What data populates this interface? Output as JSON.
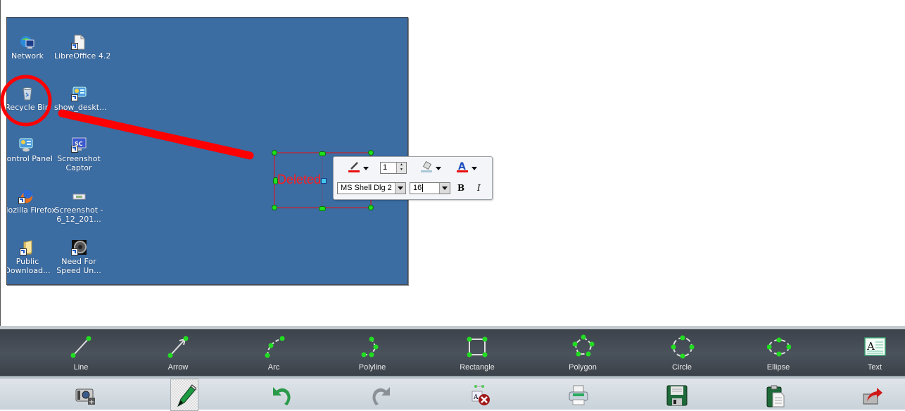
{
  "desktop": {
    "icons": [
      {
        "name": "network",
        "label": "Network",
        "icon": "network-icon"
      },
      {
        "name": "libreoffice",
        "label": "LibreOffice 4.2",
        "icon": "document-icon"
      },
      {
        "name": "recycle-bin",
        "label": "Recycle Bin",
        "icon": "trash-icon"
      },
      {
        "name": "show-desktop",
        "label": "show_deskt...",
        "icon": "app-shortcut-icon"
      },
      {
        "name": "control-panel",
        "label": "Control Panel",
        "icon": "control-panel-icon"
      },
      {
        "name": "screenshot-captor",
        "label1": "Screenshot",
        "label2": "Captor",
        "icon": "screenshot-captor-icon"
      },
      {
        "name": "mozilla-firefox",
        "label": "Mozilla Firefox",
        "icon": "firefox-icon"
      },
      {
        "name": "screenshot-file",
        "label1": "Screenshot -",
        "label2": "6_12_201...",
        "icon": "image-file-icon"
      },
      {
        "name": "public-downloads",
        "label1": "Public",
        "label2": "Download...",
        "icon": "folder-icon"
      },
      {
        "name": "need-for-speed",
        "label1": "Need For",
        "label2": "Speed Un...",
        "icon": "game-icon"
      }
    ]
  },
  "annotations": {
    "text_box": {
      "text": "Deleted",
      "color": "#ff1a1a"
    },
    "highlight_color": "#ff0000"
  },
  "format_bar": {
    "line_color_icon": "pen-color-icon",
    "line_width": "1",
    "fill_color_icon": "fill-bucket-icon",
    "font_color_icon": "font-color-icon",
    "font_name": "MS Shell Dlg 2",
    "font_size": "16",
    "bold_label": "B",
    "italic_label": "I",
    "line_color": "#e81010",
    "fill_color": "#a9c7d8",
    "font_color": "#e81010"
  },
  "shape_tools": [
    {
      "id": "line",
      "label": "Line"
    },
    {
      "id": "arrow",
      "label": "Arrow"
    },
    {
      "id": "arc",
      "label": "Arc"
    },
    {
      "id": "polyline",
      "label": "Polyline"
    },
    {
      "id": "rectangle",
      "label": "Rectangle"
    },
    {
      "id": "polygon",
      "label": "Polygon"
    },
    {
      "id": "circle",
      "label": "Circle"
    },
    {
      "id": "ellipse",
      "label": "Ellipse"
    },
    {
      "id": "text",
      "label": "Text"
    }
  ],
  "actions": [
    {
      "id": "capture",
      "icon": "camera-add-icon"
    },
    {
      "id": "draw",
      "icon": "pen-icon",
      "active": true
    },
    {
      "id": "undo",
      "icon": "undo-icon"
    },
    {
      "id": "redo",
      "icon": "redo-icon"
    },
    {
      "id": "delete",
      "icon": "delete-annotation-icon"
    },
    {
      "id": "print",
      "icon": "printer-icon"
    },
    {
      "id": "save",
      "icon": "floppy-disk-icon"
    },
    {
      "id": "copy",
      "icon": "clipboard-icon"
    },
    {
      "id": "share",
      "icon": "share-icon"
    }
  ]
}
